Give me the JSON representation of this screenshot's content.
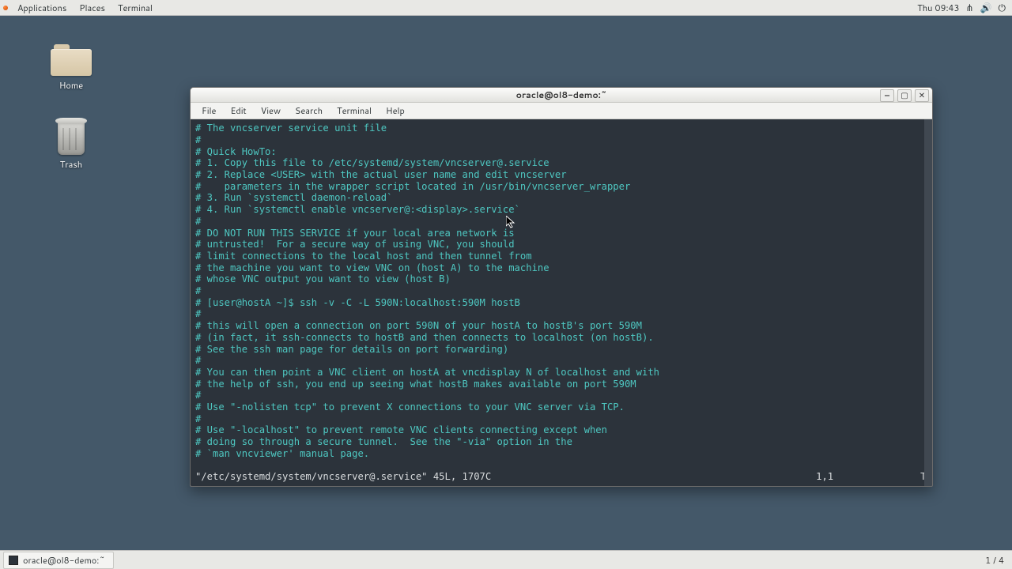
{
  "top_panel": {
    "menus": [
      "Applications",
      "Places",
      "Terminal"
    ],
    "clock": "Thu 09:43",
    "tray_icons": [
      "network-icon",
      "volume-icon",
      "power-icon"
    ]
  },
  "desktop": {
    "home_label": "Home",
    "trash_label": "Trash"
  },
  "window": {
    "title": "oracle@ol8-demo:~",
    "menus": [
      "File",
      "Edit",
      "View",
      "Search",
      "Terminal",
      "Help"
    ]
  },
  "terminal": {
    "lines": [
      "# The vncserver service unit file",
      "#",
      "# Quick HowTo:",
      "# 1. Copy this file to /etc/systemd/system/vncserver@.service",
      "# 2. Replace <USER> with the actual user name and edit vncserver",
      "#    parameters in the wrapper script located in /usr/bin/vncserver_wrapper",
      "# 3. Run `systemctl daemon-reload`",
      "# 4. Run `systemctl enable vncserver@:<display>.service`",
      "#",
      "# DO NOT RUN THIS SERVICE if your local area network is",
      "# untrusted!  For a secure way of using VNC, you should",
      "# limit connections to the local host and then tunnel from",
      "# the machine you want to view VNC on (host A) to the machine",
      "# whose VNC output you want to view (host B)",
      "#",
      "# [user@hostA ~]$ ssh -v -C -L 590N:localhost:590M hostB",
      "#",
      "# this will open a connection on port 590N of your hostA to hostB's port 590M",
      "# (in fact, it ssh-connects to hostB and then connects to localhost (on hostB).",
      "# See the ssh man page for details on port forwarding)",
      "#",
      "# You can then point a VNC client on hostA at vncdisplay N of localhost and with",
      "# the help of ssh, you end up seeing what hostB makes available on port 590M",
      "#",
      "# Use \"-nolisten tcp\" to prevent X connections to your VNC server via TCP.",
      "#",
      "# Use \"-localhost\" to prevent remote VNC clients connecting except when",
      "# doing so through a secure tunnel.  See the \"-via\" option in the",
      "# `man vncviewer' manual page.",
      ""
    ],
    "status_file": "\"/etc/systemd/system/vncserver@.service\" 45L, 1707C",
    "status_pos": "1,1",
    "status_scroll": "Top"
  },
  "taskbar": {
    "entry": "oracle@ol8-demo:~",
    "workspace": "1 / 4"
  }
}
